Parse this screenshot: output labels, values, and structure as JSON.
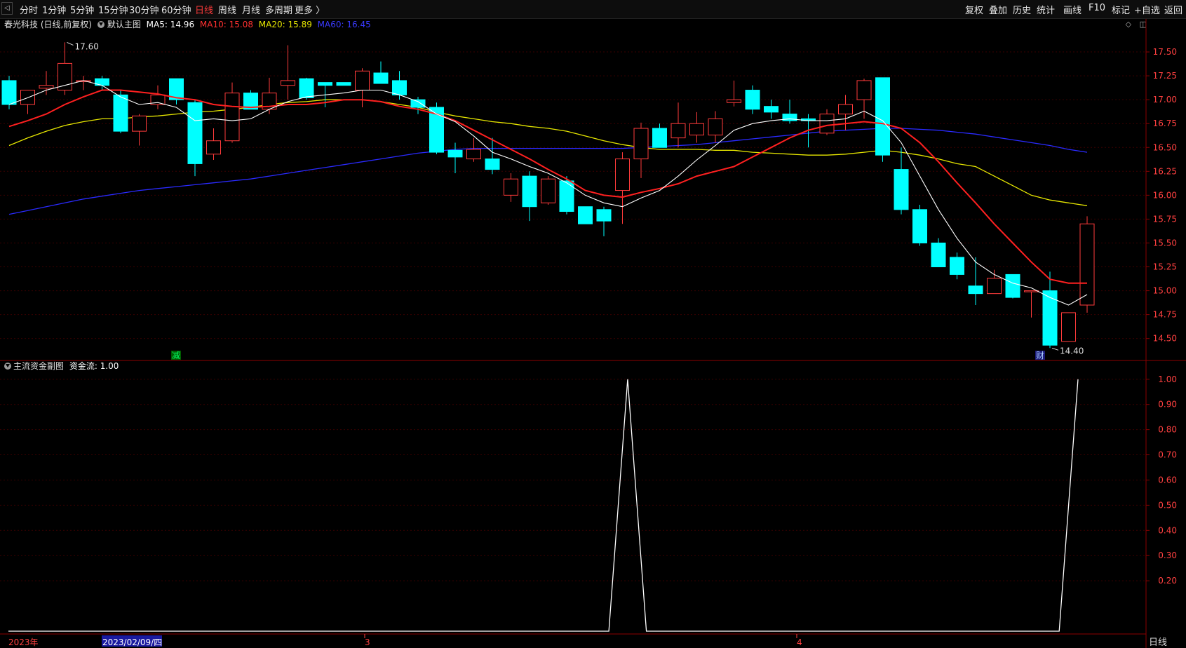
{
  "toolbar": {
    "periods": [
      "分时",
      "1分钟",
      "5分钟",
      "15分钟",
      "30分钟",
      "60分钟",
      "日线",
      "周线",
      "月线",
      "多周期",
      "更多 〉"
    ],
    "active_period": "日线",
    "right_items": [
      "复权",
      "叠加",
      "历史",
      "统计",
      "画线",
      "F10",
      "标记",
      "+自选",
      "返回"
    ]
  },
  "header": {
    "stock": "春光科技 (日线,前复权)",
    "main_name": "默认主图",
    "ma5": "MA5: 14.96",
    "ma10": "MA10: 15.08",
    "ma20": "MA20: 15.89",
    "ma60": "MA60: 16.45"
  },
  "colors": {
    "up": "#ff3b3b",
    "down": "#00ffff",
    "ma5": "#ffffff",
    "ma10": "#ff2020",
    "ma20": "#e6e600",
    "ma60": "#2a2aff",
    "frame": "#8b0000",
    "axis_text": "#ff4040",
    "flow_line": "#ffffff"
  },
  "sub_header": {
    "name": "主流资金副图",
    "value": "资金流: 1.00"
  },
  "x_axis": {
    "labels": [
      "2023年",
      "2023/02/09/四",
      "3",
      "4"
    ]
  },
  "annotations": {
    "high": "17.60",
    "low": "14.40",
    "marker_reduce": "减",
    "marker_finance": "财"
  },
  "bottom_right_label": "日线",
  "chart_data": [
    {
      "type": "candlestick",
      "y_ticks": [
        "17.50",
        "17.25",
        "17.00",
        "16.75",
        "16.50",
        "16.25",
        "16.00",
        "15.75",
        "15.50",
        "15.25",
        "15.00",
        "14.75",
        "14.50"
      ],
      "ylim": [
        14.27,
        17.75
      ],
      "candles": [
        {
          "o": 17.2,
          "h": 17.25,
          "l": 16.9,
          "c": 16.95
        },
        {
          "o": 16.95,
          "h": 17.05,
          "l": 16.85,
          "c": 17.1
        },
        {
          "o": 17.12,
          "h": 17.3,
          "l": 17.05,
          "c": 17.15
        },
        {
          "o": 17.1,
          "h": 17.6,
          "l": 17.05,
          "c": 17.38
        },
        {
          "o": 17.2,
          "h": 17.25,
          "l": 17.1,
          "c": 17.2
        },
        {
          "o": 17.22,
          "h": 17.25,
          "l": 17.1,
          "c": 17.15
        },
        {
          "o": 17.05,
          "h": 17.1,
          "l": 16.65,
          "c": 16.67
        },
        {
          "o": 16.67,
          "h": 16.85,
          "l": 16.52,
          "c": 16.83
        },
        {
          "o": 16.95,
          "h": 17.15,
          "l": 16.9,
          "c": 17.05
        },
        {
          "o": 17.22,
          "h": 17.22,
          "l": 16.95,
          "c": 17.0
        },
        {
          "o": 16.97,
          "h": 17.0,
          "l": 16.2,
          "c": 16.33
        },
        {
          "o": 16.43,
          "h": 16.7,
          "l": 16.37,
          "c": 16.57
        },
        {
          "o": 16.57,
          "h": 17.18,
          "l": 16.55,
          "c": 17.07
        },
        {
          "o": 17.07,
          "h": 17.1,
          "l": 16.9,
          "c": 16.9
        },
        {
          "o": 16.9,
          "h": 17.23,
          "l": 16.85,
          "c": 17.07
        },
        {
          "o": 17.15,
          "h": 17.57,
          "l": 17.0,
          "c": 17.2
        },
        {
          "o": 17.22,
          "h": 17.23,
          "l": 17.0,
          "c": 17.02
        },
        {
          "o": 17.18,
          "h": 17.18,
          "l": 16.92,
          "c": 17.15
        },
        {
          "o": 17.18,
          "h": 17.18,
          "l": 17.15,
          "c": 17.15
        },
        {
          "o": 17.1,
          "h": 17.33,
          "l": 16.92,
          "c": 17.3
        },
        {
          "o": 17.28,
          "h": 17.4,
          "l": 17.2,
          "c": 17.17
        },
        {
          "o": 17.2,
          "h": 17.3,
          "l": 17.0,
          "c": 17.05
        },
        {
          "o": 17.0,
          "h": 17.03,
          "l": 16.85,
          "c": 16.92
        },
        {
          "o": 16.92,
          "h": 16.97,
          "l": 16.43,
          "c": 16.45
        },
        {
          "o": 16.47,
          "h": 16.55,
          "l": 16.23,
          "c": 16.4
        },
        {
          "o": 16.38,
          "h": 16.6,
          "l": 16.35,
          "c": 16.48
        },
        {
          "o": 16.38,
          "h": 16.6,
          "l": 16.22,
          "c": 16.27
        },
        {
          "o": 16.0,
          "h": 16.23,
          "l": 15.93,
          "c": 16.17
        },
        {
          "o": 16.2,
          "h": 16.25,
          "l": 15.73,
          "c": 15.88
        },
        {
          "o": 15.92,
          "h": 16.2,
          "l": 15.9,
          "c": 16.17
        },
        {
          "o": 16.15,
          "h": 16.2,
          "l": 15.8,
          "c": 15.83
        },
        {
          "o": 15.88,
          "h": 15.88,
          "l": 15.7,
          "c": 15.7
        },
        {
          "o": 15.85,
          "h": 15.88,
          "l": 15.57,
          "c": 15.73
        },
        {
          "o": 16.05,
          "h": 16.45,
          "l": 15.7,
          "c": 16.38
        },
        {
          "o": 16.38,
          "h": 16.76,
          "l": 16.18,
          "c": 16.7
        },
        {
          "o": 16.7,
          "h": 16.75,
          "l": 16.5,
          "c": 16.5
        },
        {
          "o": 16.6,
          "h": 16.97,
          "l": 16.5,
          "c": 16.75
        },
        {
          "o": 16.63,
          "h": 16.87,
          "l": 16.55,
          "c": 16.75
        },
        {
          "o": 16.63,
          "h": 16.88,
          "l": 16.55,
          "c": 16.8
        },
        {
          "o": 16.97,
          "h": 17.2,
          "l": 16.93,
          "c": 17.0
        },
        {
          "o": 17.1,
          "h": 17.15,
          "l": 16.85,
          "c": 16.9
        },
        {
          "o": 16.93,
          "h": 17.0,
          "l": 16.8,
          "c": 16.87
        },
        {
          "o": 16.85,
          "h": 17.0,
          "l": 16.75,
          "c": 16.78
        },
        {
          "o": 16.8,
          "h": 16.85,
          "l": 16.5,
          "c": 16.78
        },
        {
          "o": 16.65,
          "h": 16.9,
          "l": 16.63,
          "c": 16.85
        },
        {
          "o": 16.85,
          "h": 17.05,
          "l": 16.68,
          "c": 16.95
        },
        {
          "o": 17.0,
          "h": 17.22,
          "l": 16.8,
          "c": 17.2
        },
        {
          "o": 17.23,
          "h": 17.23,
          "l": 16.35,
          "c": 16.42
        },
        {
          "o": 16.27,
          "h": 16.5,
          "l": 15.8,
          "c": 15.85
        },
        {
          "o": 15.85,
          "h": 15.9,
          "l": 15.47,
          "c": 15.5
        },
        {
          "o": 15.5,
          "h": 15.55,
          "l": 15.25,
          "c": 15.25
        },
        {
          "o": 15.35,
          "h": 15.4,
          "l": 15.12,
          "c": 15.17
        },
        {
          "o": 15.05,
          "h": 15.35,
          "l": 14.85,
          "c": 14.97
        },
        {
          "o": 14.97,
          "h": 15.22,
          "l": 14.97,
          "c": 15.13
        },
        {
          "o": 15.17,
          "h": 15.17,
          "l": 14.92,
          "c": 14.93
        },
        {
          "o": 15.0,
          "h": 15.0,
          "l": 14.72,
          "c": 15.0
        },
        {
          "o": 15.0,
          "h": 15.2,
          "l": 14.4,
          "c": 14.43
        },
        {
          "o": 14.47,
          "h": 14.77,
          "l": 14.47,
          "c": 14.77
        },
        {
          "o": 14.85,
          "h": 15.78,
          "l": 14.77,
          "c": 15.7
        }
      ],
      "ma5": [
        16.95,
        17.02,
        17.1,
        17.15,
        17.2,
        17.15,
        17.03,
        16.95,
        16.97,
        16.92,
        16.78,
        16.8,
        16.78,
        16.8,
        16.9,
        16.98,
        17.03,
        17.05,
        17.07,
        17.1,
        17.1,
        17.05,
        16.98,
        16.85,
        16.77,
        16.62,
        16.45,
        16.38,
        16.3,
        16.23,
        16.13,
        16.0,
        15.92,
        15.88,
        15.97,
        16.05,
        16.2,
        16.37,
        16.52,
        16.68,
        16.75,
        16.78,
        16.8,
        16.78,
        16.78,
        16.8,
        16.88,
        16.78,
        16.55,
        16.2,
        15.85,
        15.55,
        15.3,
        15.17,
        15.08,
        15.03,
        14.93,
        14.85,
        14.96
      ],
      "ma10": [
        16.72,
        16.78,
        16.85,
        16.95,
        17.03,
        17.1,
        17.1,
        17.08,
        17.06,
        17.02,
        17.0,
        16.95,
        16.93,
        16.92,
        16.93,
        16.95,
        16.95,
        16.97,
        17.0,
        17.0,
        16.98,
        16.93,
        16.9,
        16.85,
        16.78,
        16.68,
        16.58,
        16.48,
        16.38,
        16.27,
        16.17,
        16.05,
        16.0,
        15.98,
        16.03,
        16.07,
        16.12,
        16.2,
        16.25,
        16.3,
        16.4,
        16.5,
        16.6,
        16.68,
        16.73,
        16.75,
        16.77,
        16.75,
        16.7,
        16.55,
        16.35,
        16.13,
        15.92,
        15.7,
        15.5,
        15.3,
        15.12,
        15.08,
        15.08
      ],
      "ma20": [
        16.52,
        16.6,
        16.67,
        16.73,
        16.77,
        16.8,
        16.8,
        16.82,
        16.83,
        16.85,
        16.87,
        16.88,
        16.9,
        16.92,
        16.95,
        16.97,
        16.98,
        17.0,
        17.0,
        17.0,
        16.98,
        16.95,
        16.92,
        16.87,
        16.83,
        16.8,
        16.77,
        16.75,
        16.72,
        16.7,
        16.67,
        16.62,
        16.57,
        16.53,
        16.5,
        16.48,
        16.48,
        16.48,
        16.47,
        16.47,
        16.45,
        16.44,
        16.43,
        16.42,
        16.42,
        16.43,
        16.45,
        16.47,
        16.45,
        16.42,
        16.38,
        16.33,
        16.3,
        16.2,
        16.1,
        16.0,
        15.95,
        15.92,
        15.89
      ],
      "ma60": [
        15.8,
        15.84,
        15.88,
        15.92,
        15.96,
        15.99,
        16.02,
        16.05,
        16.07,
        16.09,
        16.11,
        16.13,
        16.15,
        16.17,
        16.2,
        16.23,
        16.26,
        16.29,
        16.32,
        16.35,
        16.38,
        16.41,
        16.44,
        16.46,
        16.48,
        16.49,
        16.49,
        16.49,
        16.49,
        16.49,
        16.49,
        16.49,
        16.49,
        16.49,
        16.5,
        16.51,
        16.52,
        16.53,
        16.55,
        16.57,
        16.59,
        16.61,
        16.63,
        16.65,
        16.67,
        16.68,
        16.69,
        16.7,
        16.7,
        16.69,
        16.68,
        16.66,
        16.64,
        16.61,
        16.58,
        16.55,
        16.52,
        16.48,
        16.45
      ]
    },
    {
      "type": "line",
      "name": "资金流",
      "y_ticks": [
        "1.00",
        "0.90",
        "0.80",
        "0.70",
        "0.60",
        "0.50",
        "0.40",
        "0.30",
        "0.20"
      ],
      "ylim": [
        0.0,
        1.03
      ],
      "values": [
        0,
        0,
        0,
        0,
        0,
        0,
        0,
        0,
        0,
        0,
        0,
        0,
        0,
        0,
        0,
        0,
        0,
        0,
        0,
        0,
        0,
        0,
        0,
        0,
        0,
        0,
        0,
        0,
        0,
        0,
        0,
        0,
        0,
        1,
        0,
        0,
        0,
        0,
        0,
        0,
        0,
        0,
        0,
        0,
        0,
        0,
        0,
        0,
        0,
        0,
        0,
        0,
        0,
        0,
        0,
        0,
        0,
        1
      ]
    }
  ]
}
